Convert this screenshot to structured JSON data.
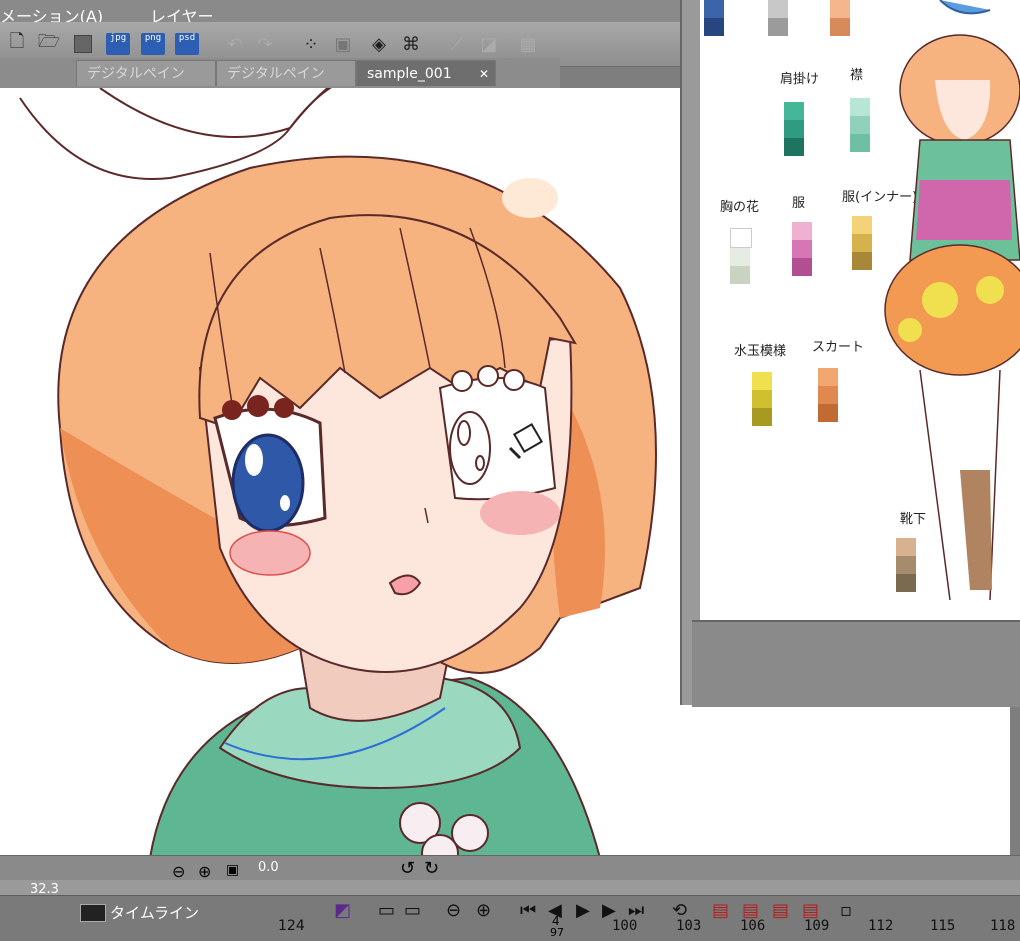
{
  "menu": {
    "animation": "メーション(A)",
    "next": "レイヤー"
  },
  "tabs": [
    {
      "label": "デジタルペイン"
    },
    {
      "label": "デジタルペイン"
    },
    {
      "label": "sample_001",
      "close": "✕"
    }
  ],
  "toolbar": {
    "jpg": "jpg",
    "png": "png",
    "psd": "psd"
  },
  "status": {
    "zoom": "32.3",
    "angle": "0.0"
  },
  "timeline": {
    "title": "タイムライン",
    "frame_count": "124",
    "current_frame": "4",
    "frames": [
      "100",
      "103",
      "106",
      "109",
      "112",
      "115",
      "118"
    ],
    "sub_frame": "97"
  },
  "reference": {
    "labels": {
      "shoulder": "肩掛け",
      "collar": "襟",
      "chest_flower": "胸の花",
      "clothes": "服",
      "clothes_inner": "服(インナー)",
      "polka": "水玉模様",
      "skirt": "スカート",
      "socks": "靴下"
    }
  },
  "colors": {
    "hair": "#f6b37f",
    "hair_shadow": "#ee8f55",
    "skin": "#fde6dc",
    "outfit": "#78c8a8",
    "outfit_dark": "#58b08c",
    "outline": "#5a2a2a",
    "ui_gray": "#8a8a8a"
  }
}
